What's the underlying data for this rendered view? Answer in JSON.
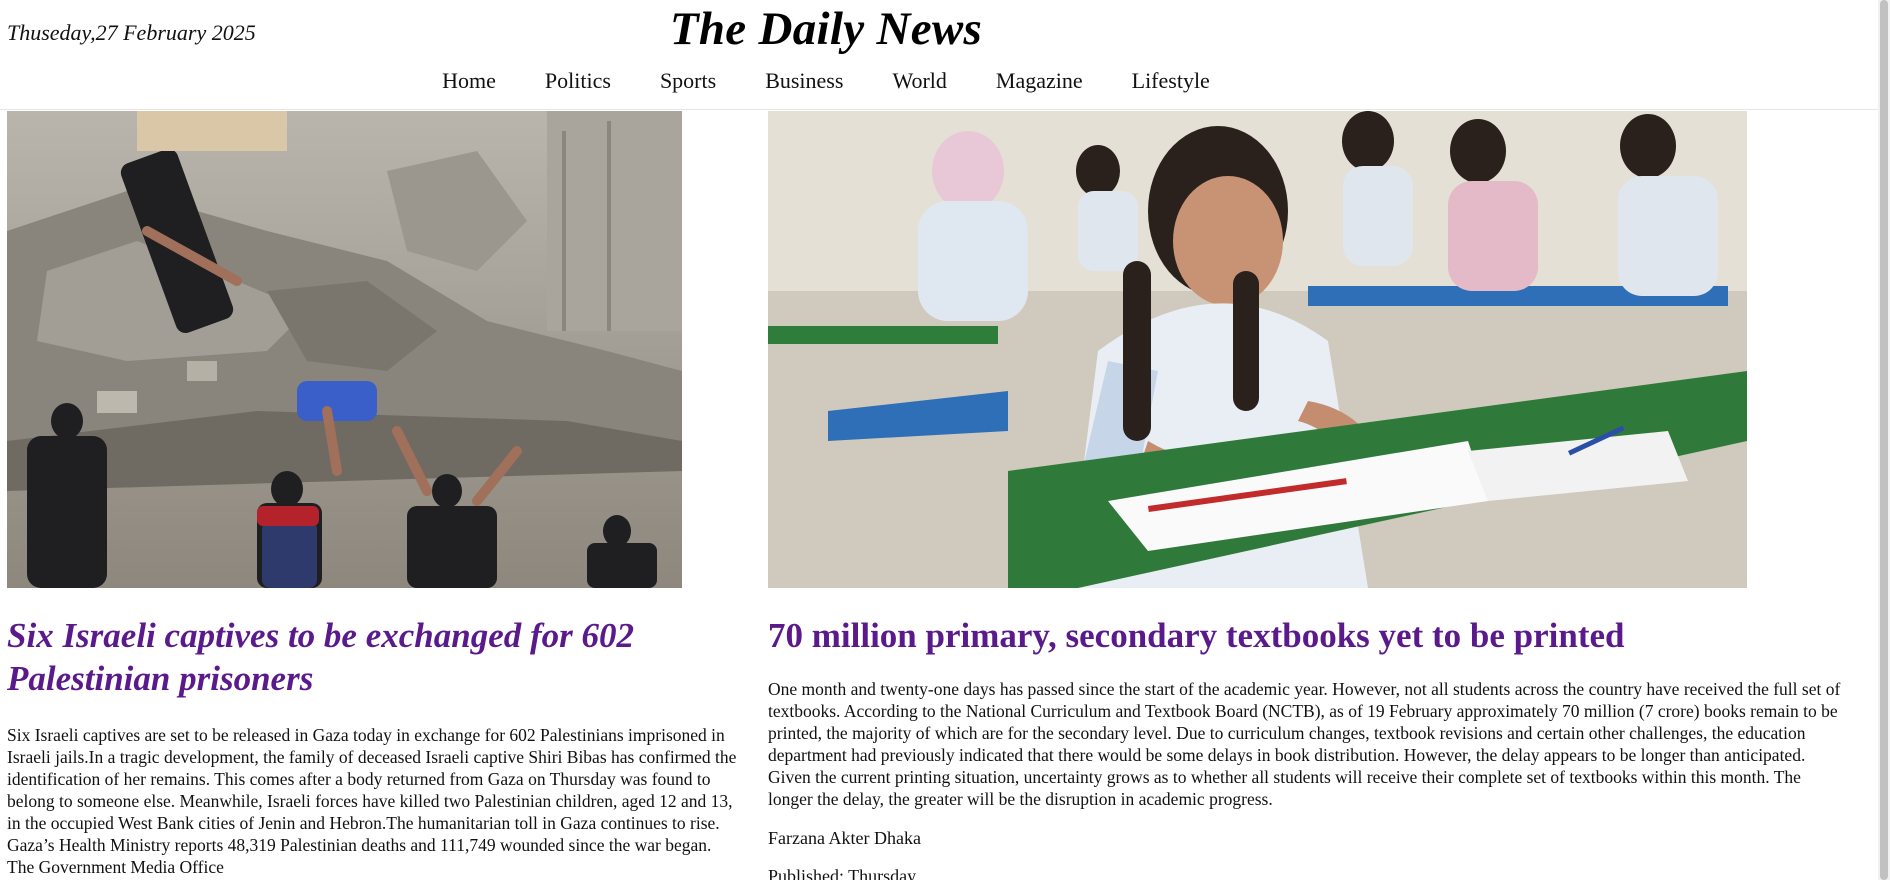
{
  "header": {
    "date": "Thuseday,27 February 2025",
    "title": "The Daily News"
  },
  "nav": {
    "items": [
      "Home",
      "Politics",
      "Sports",
      "Business",
      "World",
      "Magazine",
      "Lifestyle"
    ]
  },
  "articles": [
    {
      "image_subject": "rubble-rescue-photo",
      "headline": "Six Israeli captives to be exchanged for 602 Palestinian prisoners",
      "body": "Six Israeli captives are set to be released in Gaza today in exchange for 602 Palestinians imprisoned in Israeli jails.In a tragic development, the family of deceased Israeli captive Shiri Bibas has confirmed the identification of her remains. This comes after a body returned from Gaza on Thursday was found to belong to someone else. Meanwhile, Israeli forces have killed two Palestinian children, aged 12 and 13, in the occupied West Bank cities of Jenin and Hebron.The humanitarian toll in Gaza continues to rise. Gaza’s Health Ministry reports 48,319 Palestinian deaths and 111,749 wounded since the war began. The Government Media Office"
    },
    {
      "image_subject": "students-classroom-photo",
      "headline": "70 million primary, secondary textbooks yet to be printed",
      "body": "One month and twenty-one days has passed since the start of the academic year. However, not all students across the country have received the full set of textbooks. According to the National Curriculum and Textbook Board (NCTB), as of 19 February approximately 70 million (7 crore) books remain to be printed, the majority of which are for the secondary level. Due to curriculum changes, textbook revisions and certain other challenges, the education department had previously indicated that there would be some delays in book distribution. However, the delay appears to be longer than anticipated. Given the current printing situation, uncertainty grows as to whether all students will receive their complete set of textbooks within this month. The longer the delay, the greater will be the disruption in academic progress.",
      "byline": "Farzana Akter Dhaka",
      "publine": "Published: Thursday"
    }
  ],
  "colors": {
    "headline": "#5a1a8b",
    "text": "#111111",
    "background": "#ffffff"
  }
}
